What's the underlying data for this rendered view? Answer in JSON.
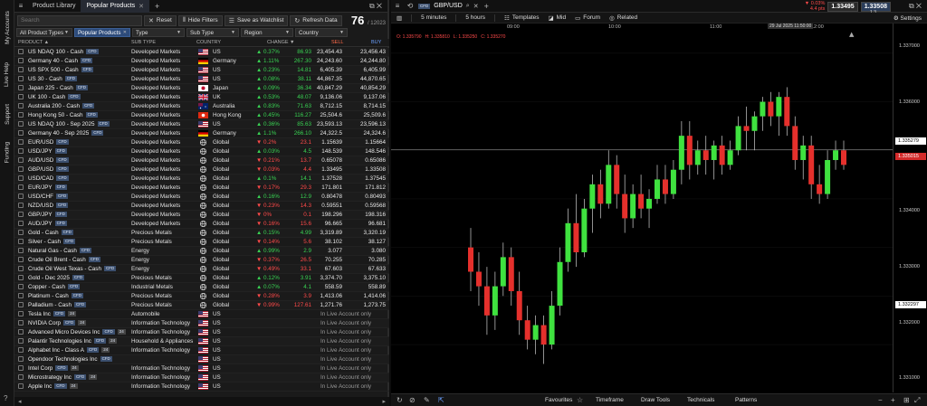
{
  "rail": [
    "My Accounts",
    "Live Help",
    "Support",
    "Funding"
  ],
  "left_tabs": {
    "product_library": "Product Library",
    "popular_products": "Popular Products"
  },
  "toolbar": {
    "search_placeholder": "Search",
    "reset": "Reset",
    "hide_filters": "Hide Filters",
    "save_watchlist": "Save as Watchlist",
    "refresh": "Refresh Data",
    "count": "76",
    "total": "/ 12023"
  },
  "filters": [
    "All Product Types",
    "Popular Products",
    "Type",
    "Sub Type",
    "Region",
    "Country"
  ],
  "columns": {
    "product": "PRODUCT ▲",
    "subtype": "SUB TYPE",
    "country": "COUNTRY",
    "change": "CHANGE ▼",
    "sell": "SELL",
    "buy": "BUY"
  },
  "cfd": "CFD",
  "rows": [
    {
      "name": "US NDAQ 100 - Cash",
      "sub": "Developed Markets",
      "flag": "us",
      "country": "US",
      "chg": "0.37%",
      "dir": "up",
      "sell": "23,454.43",
      "buy": "23,456.43",
      "mid": "86.93"
    },
    {
      "name": "Germany 40 - Cash",
      "sub": "Developed Markets",
      "flag": "de",
      "country": "Germany",
      "chg": "1.11%",
      "dir": "up",
      "sell": "24,243.60",
      "buy": "24,244.80",
      "mid": "267.30"
    },
    {
      "name": "US SPX 500 - Cash",
      "sub": "Developed Markets",
      "flag": "us",
      "country": "US",
      "chg": "0.23%",
      "dir": "up",
      "sell": "6,405.39",
      "buy": "6,405.99",
      "mid": "14.81"
    },
    {
      "name": "US 30 - Cash",
      "sub": "Developed Markets",
      "flag": "us",
      "country": "US",
      "chg": "0.08%",
      "dir": "up",
      "sell": "44,867.35",
      "buy": "44,870.65",
      "mid": "38.11"
    },
    {
      "name": "Japan 225 - Cash",
      "sub": "Developed Markets",
      "flag": "jp",
      "country": "Japan",
      "chg": "0.09%",
      "dir": "up",
      "sell": "40,847.29",
      "buy": "40,854.29",
      "mid": "36.34"
    },
    {
      "name": "UK 100 - Cash",
      "sub": "Developed Markets",
      "flag": "uk",
      "country": "UK",
      "chg": "0.53%",
      "dir": "up",
      "sell": "9,136.06",
      "buy": "9,137.06",
      "mid": "48.07"
    },
    {
      "name": "Australia 200 - Cash",
      "sub": "Developed Markets",
      "flag": "au",
      "country": "Australia",
      "chg": "0.83%",
      "dir": "up",
      "sell": "8,712.15",
      "buy": "8,714.15",
      "mid": "71.63"
    },
    {
      "name": "Hong Kong 50 - Cash",
      "sub": "Developed Markets",
      "flag": "hk",
      "country": "Hong Kong",
      "chg": "0.45%",
      "dir": "up",
      "sell": "25,504.6",
      "buy": "25,509.6",
      "mid": "116.27"
    },
    {
      "name": "US NDAQ 100 - Sep 2025",
      "sub": "Developed Markets",
      "flag": "us",
      "country": "US",
      "chg": "0.36%",
      "dir": "up",
      "sell": "23,593.13",
      "buy": "23,596.13",
      "mid": "85.63"
    },
    {
      "name": "Germany 40 - Sep 2025",
      "sub": "Developed Markets",
      "flag": "de",
      "country": "Germany",
      "chg": "1.1%",
      "dir": "up",
      "sell": "24,322.5",
      "buy": "24,324.6",
      "mid": "266.10"
    },
    {
      "name": "EUR/USD",
      "sub": "Developed Markets",
      "flag": "gl",
      "country": "Global",
      "chg": "0.2%",
      "dir": "dn",
      "sell": "1.15639",
      "buy": "1.15664",
      "mid": "23.1"
    },
    {
      "name": "USD/JPY",
      "sub": "Developed Markets",
      "flag": "gl",
      "country": "Global",
      "chg": "0.03%",
      "dir": "up",
      "sell": "148.539",
      "buy": "148.546",
      "mid": "4.5"
    },
    {
      "name": "AUD/USD",
      "sub": "Developed Markets",
      "flag": "gl",
      "country": "Global",
      "chg": "0.21%",
      "dir": "dn",
      "sell": "0.65078",
      "buy": "0.65086",
      "mid": "13.7"
    },
    {
      "name": "GBP/USD",
      "sub": "Developed Markets",
      "flag": "gl",
      "country": "Global",
      "chg": "0.03%",
      "dir": "dn",
      "sell": "1.33495",
      "buy": "1.33508",
      "mid": "4.4"
    },
    {
      "name": "USD/CAD",
      "sub": "Developed Markets",
      "flag": "gl",
      "country": "Global",
      "chg": "0.1%",
      "dir": "up",
      "sell": "1.37528",
      "buy": "1.37545",
      "mid": "14.1"
    },
    {
      "name": "EUR/JPY",
      "sub": "Developed Markets",
      "flag": "gl",
      "country": "Global",
      "chg": "0.17%",
      "dir": "dn",
      "sell": "171.801",
      "buy": "171.812",
      "mid": "29.3"
    },
    {
      "name": "USD/CHF",
      "sub": "Developed Markets",
      "flag": "gl",
      "country": "Global",
      "chg": "0.16%",
      "dir": "up",
      "sell": "0.80478",
      "buy": "0.80493",
      "mid": "12.9"
    },
    {
      "name": "NZD/USD",
      "sub": "Developed Markets",
      "flag": "gl",
      "country": "Global",
      "chg": "0.23%",
      "dir": "dn",
      "sell": "0.59551",
      "buy": "0.59568",
      "mid": "14.3"
    },
    {
      "name": "GBP/JPY",
      "sub": "Developed Markets",
      "flag": "gl",
      "country": "Global",
      "chg": "0%",
      "dir": "dn",
      "sell": "198.296",
      "buy": "198.316",
      "mid": "0.1"
    },
    {
      "name": "AUD/JPY",
      "sub": "Developed Markets",
      "flag": "gl",
      "country": "Global",
      "chg": "0.16%",
      "dir": "dn",
      "sell": "96.665",
      "buy": "96.681",
      "mid": "15.6"
    },
    {
      "name": "Gold - Cash",
      "sub": "Precious Metals",
      "flag": "gl",
      "country": "Global",
      "chg": "0.15%",
      "dir": "up",
      "sell": "3,319.89",
      "buy": "3,320.19",
      "mid": "4.99"
    },
    {
      "name": "Silver - Cash",
      "sub": "Precious Metals",
      "flag": "gl",
      "country": "Global",
      "chg": "0.14%",
      "dir": "dn",
      "sell": "38.102",
      "buy": "38.127",
      "mid": "5.6"
    },
    {
      "name": "Natural Gas - Cash",
      "sub": "Energy",
      "flag": "gl",
      "country": "Global",
      "chg": "0.99%",
      "dir": "up",
      "sell": "3.077",
      "buy": "3.080",
      "mid": "2.9"
    },
    {
      "name": "Crude Oil Brent - Cash",
      "sub": "Energy",
      "flag": "gl",
      "country": "Global",
      "chg": "0.37%",
      "dir": "dn",
      "sell": "70.255",
      "buy": "70.285",
      "mid": "26.5"
    },
    {
      "name": "Crude Oil West Texas - Cash",
      "sub": "Energy",
      "flag": "gl",
      "country": "Global",
      "chg": "0.49%",
      "dir": "dn",
      "sell": "67.603",
      "buy": "67.633",
      "mid": "33.1"
    },
    {
      "name": "Gold - Dec 2025",
      "sub": "Precious Metals",
      "flag": "gl",
      "country": "Global",
      "chg": "0.12%",
      "dir": "up",
      "sell": "3,374.70",
      "buy": "3,375.10",
      "mid": "3.91"
    },
    {
      "name": "Copper - Cash",
      "sub": "Industrial Metals",
      "flag": "gl",
      "country": "Global",
      "chg": "0.07%",
      "dir": "up",
      "sell": "558.59",
      "buy": "558.89",
      "mid": "4.1"
    },
    {
      "name": "Platinum - Cash",
      "sub": "Precious Metals",
      "flag": "gl",
      "country": "Global",
      "chg": "0.28%",
      "dir": "dn",
      "sell": "1,413.06",
      "buy": "1,414.06",
      "mid": "3.9"
    },
    {
      "name": "Palladium - Cash",
      "sub": "Precious Metals",
      "flag": "gl",
      "country": "Global",
      "chg": "0.99%",
      "dir": "dn",
      "sell": "1,271.76",
      "buy": "1,273.75",
      "mid": "127.61"
    },
    {
      "name": "Tesla Inc",
      "sub": "Automobile",
      "flag": "us",
      "country": "US",
      "live": "In Live Account only",
      "tag": "24"
    },
    {
      "name": "NVIDIA Corp",
      "sub": "Information Technology",
      "flag": "us",
      "country": "US",
      "live": "In Live Account only",
      "tag": "24"
    },
    {
      "name": "Advanced Micro Devices Inc",
      "sub": "Information Technology",
      "flag": "us",
      "country": "US",
      "live": "In Live Account only",
      "tag": "24"
    },
    {
      "name": "Palantir Technologies Inc",
      "sub": "Household & Appliances",
      "flag": "us",
      "country": "US",
      "live": "In Live Account only",
      "tag": "24"
    },
    {
      "name": "Alphabet Inc - Class A",
      "sub": "Information Technology",
      "flag": "us",
      "country": "US",
      "live": "In Live Account only",
      "tag": "24"
    },
    {
      "name": "Opendoor Technologies Inc",
      "sub": "",
      "flag": "us",
      "country": "US",
      "live": "In Live Account only",
      "tag": ""
    },
    {
      "name": "Intel Corp",
      "sub": "Information Technology",
      "flag": "us",
      "country": "US",
      "live": "In Live Account only",
      "tag": "24"
    },
    {
      "name": "Microstrategy Inc",
      "sub": "Information Technology",
      "flag": "us",
      "country": "US",
      "live": "In Live Account only",
      "tag": "24"
    },
    {
      "name": "Apple Inc",
      "sub": "Information Technology",
      "flag": "us",
      "country": "US",
      "live": "In Live Account only",
      "tag": "24"
    }
  ],
  "chart_header": {
    "symbol": "GBP/USD",
    "chg1": "▼ 0.03%",
    "chg2": "4.4 pts",
    "sell": "1.33495",
    "buy": "1.33508",
    "spread": "1.3"
  },
  "chart_toolbar": {
    "timeframe1": "5 minutes",
    "timeframe2": "5 hours",
    "templates": "Templates",
    "mid": "Mid",
    "forum": "Forum",
    "related": "Related",
    "settings": "Settings"
  },
  "ohlc": {
    "o": "O: 1.335790",
    "h": "H: 1.335810",
    "l": "L: 1.335250",
    "c": "C: 1.335270"
  },
  "time_labels": [
    "09:00",
    "10:00",
    "11:00",
    "12:00"
  ],
  "datetime_box": "29 Jul 2025 11:50:00",
  "price_labels": [
    "1.337000",
    "1.336000",
    "1.335000",
    "1.334000",
    "1.333000",
    "1.332000",
    "1.331000"
  ],
  "price_boxes": {
    "high": "1.335279",
    "last": "1.335015",
    "low": "1.332297"
  },
  "chart_footer": {
    "favourites": "Favourites",
    "timeframe": "Timeframe",
    "draw_tools": "Draw Tools",
    "technicals": "Technicals",
    "patterns": "Patterns"
  },
  "chart_data": {
    "type": "candlestick",
    "symbol": "GBP/USD",
    "candles": [
      {
        "o": 1.333,
        "h": 1.3334,
        "l": 1.3321,
        "c": 1.3325
      },
      {
        "o": 1.3325,
        "h": 1.3329,
        "l": 1.3318,
        "c": 1.3322
      },
      {
        "o": 1.3322,
        "h": 1.3326,
        "l": 1.3312,
        "c": 1.3316
      },
      {
        "o": 1.3316,
        "h": 1.3325,
        "l": 1.3313,
        "c": 1.3322
      },
      {
        "o": 1.3322,
        "h": 1.3331,
        "l": 1.332,
        "c": 1.3328
      },
      {
        "o": 1.3328,
        "h": 1.333,
        "l": 1.3318,
        "c": 1.3321
      },
      {
        "o": 1.3321,
        "h": 1.3325,
        "l": 1.3312,
        "c": 1.3315
      },
      {
        "o": 1.3315,
        "h": 1.3318,
        "l": 1.3309,
        "c": 1.3311
      },
      {
        "o": 1.3311,
        "h": 1.3316,
        "l": 1.3308,
        "c": 1.3314
      },
      {
        "o": 1.3314,
        "h": 1.3316,
        "l": 1.3306,
        "c": 1.331
      },
      {
        "o": 1.331,
        "h": 1.3321,
        "l": 1.3309,
        "c": 1.3318
      },
      {
        "o": 1.3318,
        "h": 1.333,
        "l": 1.3316,
        "c": 1.3327
      },
      {
        "o": 1.3327,
        "h": 1.3338,
        "l": 1.3325,
        "c": 1.3335
      },
      {
        "o": 1.3335,
        "h": 1.3341,
        "l": 1.3326,
        "c": 1.3329
      },
      {
        "o": 1.3329,
        "h": 1.334,
        "l": 1.3328,
        "c": 1.3338
      },
      {
        "o": 1.3338,
        "h": 1.3345,
        "l": 1.3333,
        "c": 1.3343
      },
      {
        "o": 1.3343,
        "h": 1.3346,
        "l": 1.3336,
        "c": 1.3339
      },
      {
        "o": 1.3339,
        "h": 1.335,
        "l": 1.3338,
        "c": 1.3347
      },
      {
        "o": 1.3347,
        "h": 1.3349,
        "l": 1.3338,
        "c": 1.3341
      },
      {
        "o": 1.3341,
        "h": 1.3345,
        "l": 1.3333,
        "c": 1.3336
      },
      {
        "o": 1.3336,
        "h": 1.3343,
        "l": 1.3334,
        "c": 1.3341
      },
      {
        "o": 1.3341,
        "h": 1.3345,
        "l": 1.3336,
        "c": 1.3338
      },
      {
        "o": 1.3338,
        "h": 1.3342,
        "l": 1.3334,
        "c": 1.334
      },
      {
        "o": 1.334,
        "h": 1.3347,
        "l": 1.3339,
        "c": 1.3344
      },
      {
        "o": 1.3344,
        "h": 1.3347,
        "l": 1.3339,
        "c": 1.3341
      },
      {
        "o": 1.3341,
        "h": 1.3348,
        "l": 1.334,
        "c": 1.3346
      },
      {
        "o": 1.3346,
        "h": 1.3356,
        "l": 1.3343,
        "c": 1.3353
      },
      {
        "o": 1.3353,
        "h": 1.3356,
        "l": 1.3344,
        "c": 1.3347
      },
      {
        "o": 1.3347,
        "h": 1.3352,
        "l": 1.3345,
        "c": 1.335
      },
      {
        "o": 1.335,
        "h": 1.3353,
        "l": 1.3345,
        "c": 1.3348
      },
      {
        "o": 1.3348,
        "h": 1.3352,
        "l": 1.3344,
        "c": 1.3351
      },
      {
        "o": 1.3351,
        "h": 1.3353,
        "l": 1.3345,
        "c": 1.3347
      },
      {
        "o": 1.3347,
        "h": 1.3352,
        "l": 1.3346,
        "c": 1.335
      },
      {
        "o": 1.335,
        "h": 1.3357,
        "l": 1.3349,
        "c": 1.3355
      },
      {
        "o": 1.3355,
        "h": 1.3359,
        "l": 1.335,
        "c": 1.3354
      },
      {
        "o": 1.3354,
        "h": 1.3358,
        "l": 1.335,
        "c": 1.3357
      },
      {
        "o": 1.3357,
        "h": 1.3361,
        "l": 1.3354,
        "c": 1.336
      },
      {
        "o": 1.336,
        "h": 1.3362,
        "l": 1.3355,
        "c": 1.3357
      },
      {
        "o": 1.3357,
        "h": 1.3362,
        "l": 1.3353,
        "c": 1.3361
      },
      {
        "o": 1.3361,
        "h": 1.3363,
        "l": 1.3353,
        "c": 1.3355
      },
      {
        "o": 1.3355,
        "h": 1.3357,
        "l": 1.3346,
        "c": 1.3348
      },
      {
        "o": 1.3348,
        "h": 1.3353,
        "l": 1.3344,
        "c": 1.3351
      },
      {
        "o": 1.3351,
        "h": 1.3353,
        "l": 1.334,
        "c": 1.3343
      },
      {
        "o": 1.3343,
        "h": 1.3347,
        "l": 1.3339,
        "c": 1.3341
      },
      {
        "o": 1.3341,
        "h": 1.335,
        "l": 1.334,
        "c": 1.3348
      },
      {
        "o": 1.3348,
        "h": 1.3352,
        "l": 1.3346,
        "c": 1.335
      },
      {
        "o": 1.335,
        "h": 1.3352,
        "l": 1.3346,
        "c": 1.3347
      }
    ],
    "ylim": [
      1.3302,
      1.3375
    ],
    "xlabels": [
      "09:00",
      "10:00",
      "11:00",
      "12:00"
    ],
    "current_price": 1.335015
  }
}
